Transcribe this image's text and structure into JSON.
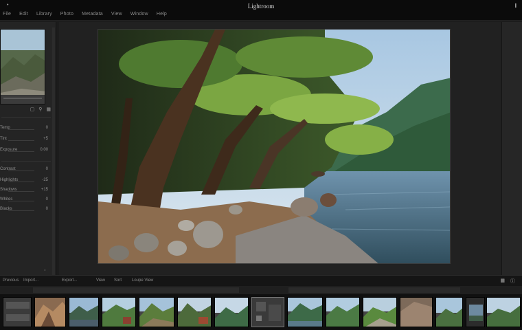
{
  "app": {
    "title": "Lightroom",
    "window_control": "I",
    "corner": "•"
  },
  "menu": {
    "items": [
      "File",
      "Edit",
      "Library",
      "Photo",
      "Metadata",
      "View",
      "Window",
      "Help"
    ]
  },
  "left_panel": {
    "nav_icons": [
      "fit-icon",
      "zoom-icon",
      "grid-icon"
    ],
    "sliders": [
      {
        "label": "Temp",
        "value": "0"
      },
      {
        "label": "Tint",
        "value": "+5"
      },
      {
        "label": "Exposure",
        "value": "0.00"
      },
      {
        "label": "Contrast",
        "value": "0"
      },
      {
        "label": "Highlights",
        "value": "-25"
      },
      {
        "label": "Shadows",
        "value": "+15"
      },
      {
        "label": "Whites",
        "value": "0"
      },
      {
        "label": "Blacks",
        "value": "0"
      }
    ]
  },
  "toolbar": {
    "items": [
      "Previous",
      "Import...",
      "Export...",
      "View",
      "Sort",
      "Loupe View"
    ],
    "right_icons": [
      "filter-icon",
      "info-icon"
    ]
  },
  "filmstrip": {
    "count": 14,
    "selected_index": 6
  },
  "colors": {
    "accent": "#6f8f3e",
    "background": "#1c1c1c",
    "panel": "#242424"
  }
}
